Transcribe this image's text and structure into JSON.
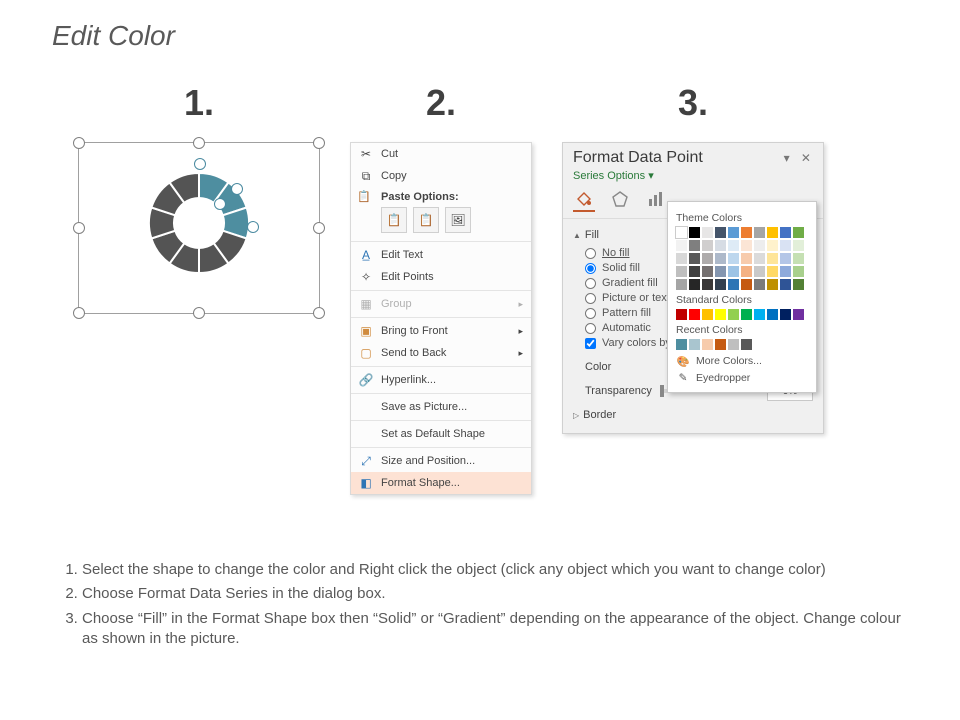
{
  "title": "Edit Color",
  "steps": {
    "n1": "1.",
    "n2": "2.",
    "n3": "3."
  },
  "menu": {
    "cut": "Cut",
    "copy": "Copy",
    "paste_label": "Paste Options:",
    "edit_text": "Edit Text",
    "edit_points": "Edit Points",
    "group": "Group",
    "bring_front": "Bring to Front",
    "send_back": "Send to Back",
    "hyperlink": "Hyperlink...",
    "save_pic": "Save as Picture...",
    "set_default": "Set as Default Shape",
    "size_pos": "Size and Position...",
    "format_shape": "Format Shape..."
  },
  "pane": {
    "title": "Format Data Point",
    "sub": "Series Options ▾",
    "close": "▾  ✕",
    "fill_h": "Fill",
    "border_h": "Border",
    "r_no": "No fill",
    "r_solid": "Solid fill",
    "r_grad": "Gradient fill",
    "r_pic": "Picture or texture fill",
    "r_patt": "Pattern fill",
    "r_auto": "Automatic",
    "r_vary": "Vary colors by point",
    "color_lbl": "Color",
    "trans_lbl": "Transparency",
    "pct": "0%"
  },
  "picker": {
    "theme": "Theme Colors",
    "standard": "Standard Colors",
    "recent": "Recent Colors",
    "more": "More Colors...",
    "eyedrop": "Eyedropper"
  },
  "theme_row1": [
    "#ffffff",
    "#000000",
    "#e7e6e6",
    "#44546a",
    "#5b9bd5",
    "#ed7d31",
    "#a5a5a5",
    "#ffc000",
    "#4472c4",
    "#70ad47"
  ],
  "theme_row2": [
    "#f2f2f2",
    "#7f7f7f",
    "#d0cece",
    "#d6dce4",
    "#deebf6",
    "#fbe5d5",
    "#ededed",
    "#fff2cc",
    "#d9e2f3",
    "#e2efd9"
  ],
  "theme_row3": [
    "#d8d8d8",
    "#595959",
    "#aeabab",
    "#adb9ca",
    "#bdd7ee",
    "#f7cbac",
    "#dbdbdb",
    "#fee599",
    "#b4c6e7",
    "#c5e0b3"
  ],
  "theme_row4": [
    "#bfbfbf",
    "#3f3f3f",
    "#757070",
    "#8496b0",
    "#9cc3e5",
    "#f4b183",
    "#c9c9c9",
    "#ffd965",
    "#8eaadb",
    "#a8d08d"
  ],
  "theme_row5": [
    "#a5a5a5",
    "#262626",
    "#3a3838",
    "#323f4f",
    "#2e75b5",
    "#c55a11",
    "#7b7b7b",
    "#bf9000",
    "#2f5496",
    "#538135"
  ],
  "standard_row": [
    "#c00000",
    "#ff0000",
    "#ffc000",
    "#ffff00",
    "#92d050",
    "#00b050",
    "#00b0f0",
    "#0070c0",
    "#002060",
    "#7030a0"
  ],
  "recent_row": [
    "#4e8ea0",
    "#a9c5cf",
    "#f7cbac",
    "#c55a11",
    "#bfbfbf",
    "#595959"
  ],
  "instructions": {
    "i1": "Select the shape to change the color and Right click the object (click any object which you want to change color)",
    "i2": "Choose Format Data Series in the dialog box.",
    "i3": "Choose “Fill” in the Format Shape box then “Solid” or “Gradient” depending on the appearance of the object. Change colour as shown in the picture."
  }
}
